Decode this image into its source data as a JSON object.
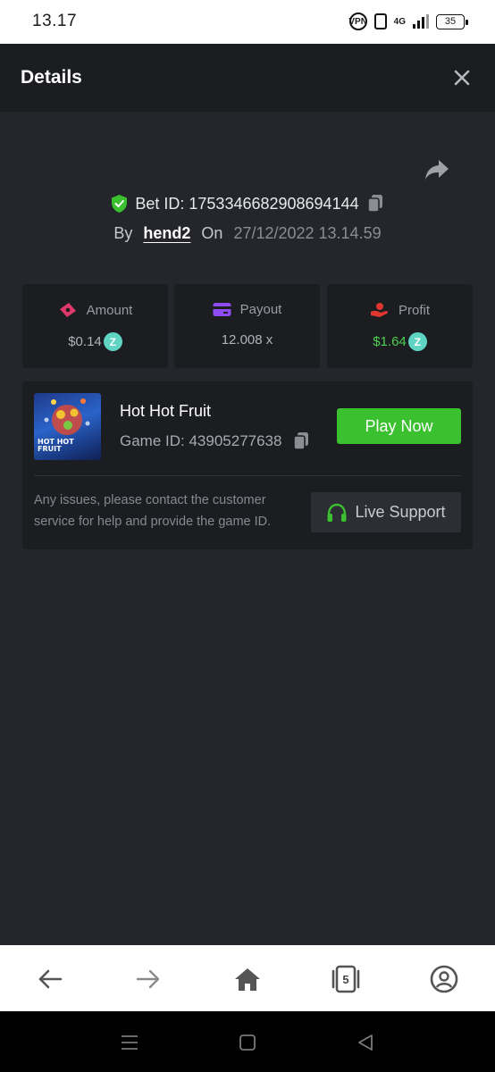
{
  "status_bar": {
    "time": "13.17",
    "vpn_label": "VPN",
    "network_label": "4G",
    "battery_level": "35"
  },
  "header": {
    "title": "Details"
  },
  "bet": {
    "bet_id": "Bet ID: 1753346682908694144",
    "by_label": "By",
    "username": "hend2",
    "on_label": "On",
    "datetime": "27/12/2022 13.14.59"
  },
  "stats": {
    "amount": {
      "label": "Amount",
      "value": "$0.14",
      "icon": "money-hand-icon",
      "color": "#e0386a"
    },
    "payout": {
      "label": "Payout",
      "value": "12.008 x",
      "icon": "card-icon",
      "color": "#8e4bf0"
    },
    "profit": {
      "label": "Profit",
      "value": "$1.64",
      "icon": "profit-hand-icon",
      "color": "#e0362f"
    }
  },
  "game": {
    "title": "Hot Hot Fruit",
    "game_id": "Game ID: 43905277638",
    "thumb_text_line1": "HOT HOT",
    "thumb_text_line2": "FRUIT",
    "play_label": "Play Now",
    "issue_text": "Any issues, please contact the customer service for help and provide the game ID.",
    "support_label": "Live Support"
  },
  "browser_nav": {
    "tabs_count": "5"
  },
  "colors": {
    "accent_green": "#3bc030",
    "profit_green": "#4fd051",
    "coin_teal": "#5fd4c3",
    "background": "#24262b",
    "panel": "#1b1d21"
  }
}
